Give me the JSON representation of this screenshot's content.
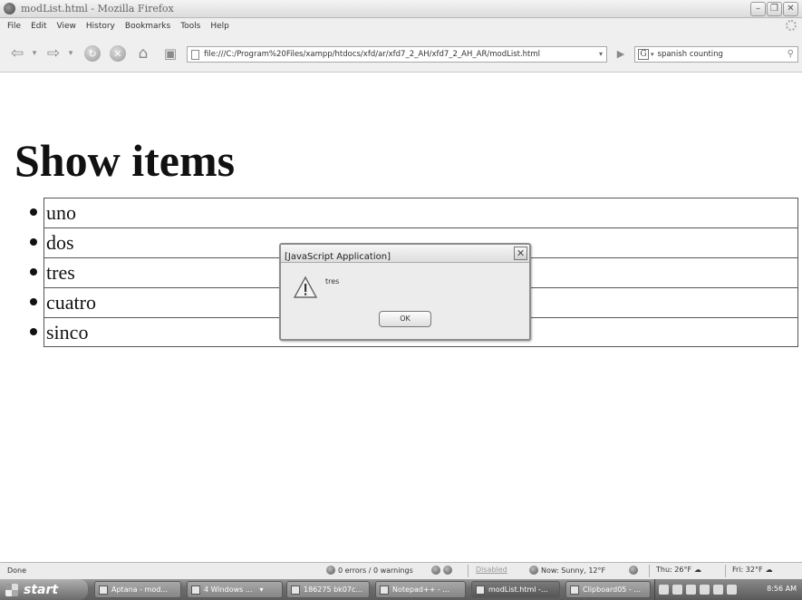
{
  "window": {
    "title": "modList.html - Mozilla Firefox"
  },
  "menubar": {
    "items": [
      "File",
      "Edit",
      "View",
      "History",
      "Bookmarks",
      "Tools",
      "Help"
    ]
  },
  "navbar": {
    "url": "file:///C:/Program%20Files/xampp/htdocs/xfd/ar/xfd7_2_AH/xfd7_2_AH_AR/modList.html",
    "search_value": "spanish counting"
  },
  "page": {
    "heading": "Show items",
    "items": [
      "uno",
      "dos",
      "tres",
      "cuatro",
      "sinco"
    ]
  },
  "dialog": {
    "title": "[JavaScript Application]",
    "message": "tres",
    "ok_label": "OK"
  },
  "statusbar": {
    "status": "Done",
    "errors": "0 errors / 0 warnings",
    "disabled": "Disabled",
    "weather_now": "Now: Sunny, 12°F",
    "weather_thu": "Thu: 26°F",
    "weather_fri": "Fri: 32°F"
  },
  "taskbar": {
    "start_label": "start",
    "tasks": [
      "Aptana - mod...",
      "4 Windows ...",
      "186275 bk07c...",
      "Notepad++ - ...",
      "modList.html -...",
      "Clipboard05 - ..."
    ],
    "clock": "8:56 AM"
  }
}
